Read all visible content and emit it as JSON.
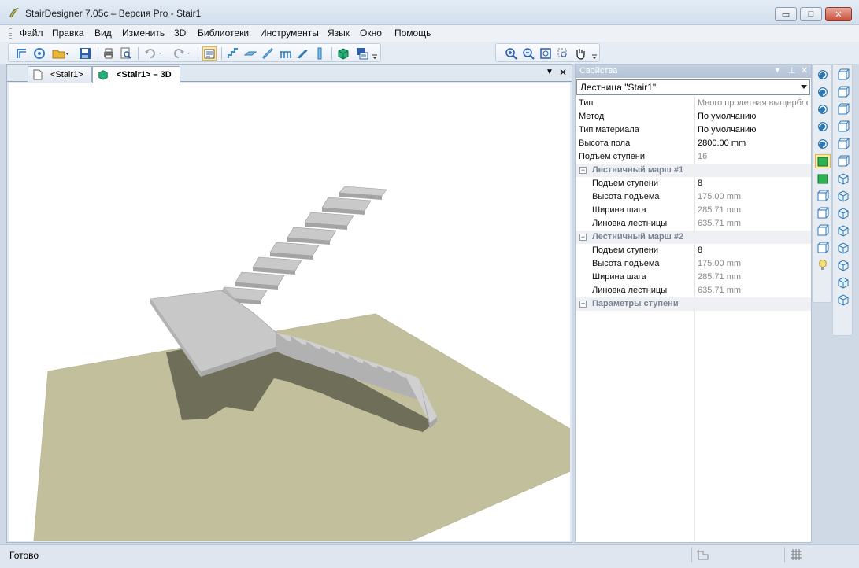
{
  "window": {
    "title": "StairDesigner 7.05c – Версия Pro - Stair1",
    "buttons": {
      "minimize": "▭",
      "maximize": "□",
      "close": "✕"
    }
  },
  "menu": {
    "items": [
      "Файл",
      "Правка",
      "Вид",
      "Изменить",
      "3D",
      "Библиотеки",
      "Инструменты",
      "Язык",
      "Окно",
      "Помощь"
    ]
  },
  "toolbar": {
    "icons": [
      "new-stair-icon",
      "rotate-icon",
      "open-folder-icon",
      "save-icon",
      "print-icon",
      "print-preview-icon",
      "undo-icon",
      "redo-icon",
      "properties-icon",
      "stair-type-icon",
      "landing-icon",
      "stringer-icon",
      "railing-icon",
      "flight-icon",
      "post-icon",
      "3d-view-icon",
      "2d-view-icon"
    ],
    "zoom_icons": [
      "zoom-in-icon",
      "zoom-out-icon",
      "zoom-extents-icon",
      "zoom-window-icon",
      "pan-hand-icon"
    ]
  },
  "tabs": [
    {
      "label": "<Stair1>",
      "active": false
    },
    {
      "label": "<Stair1> – 3D",
      "active": true
    }
  ],
  "tab_controls": {
    "dropdown": "▼",
    "close": "✕"
  },
  "properties": {
    "title": "Свойства",
    "header_controls": {
      "dropdown": "▼",
      "pin": "⊥",
      "close": "✕"
    },
    "selector": "Лестница \"Stair1\"",
    "rows": [
      {
        "name": "Тип",
        "value": "Много пролетная выщербленная",
        "gray": true,
        "kind": "top"
      },
      {
        "name": "Метод",
        "value": "По умолчанию",
        "gray": false,
        "kind": "top"
      },
      {
        "name": "Тип материала",
        "value": "По умолчанию",
        "gray": false,
        "kind": "top"
      },
      {
        "name": "Высота пола",
        "value": "2800.00 mm",
        "gray": false,
        "kind": "top"
      },
      {
        "name": "Подъем ступени",
        "value": "16",
        "gray": true,
        "kind": "top"
      },
      {
        "name": "Лестничный марш #1",
        "value": "",
        "kind": "group",
        "toggle": "−"
      },
      {
        "name": "Подъем ступени",
        "value": "8",
        "gray": false,
        "kind": "sub"
      },
      {
        "name": "Высота подъема",
        "value": "175.00 mm",
        "gray": true,
        "kind": "sub"
      },
      {
        "name": "Ширина шага",
        "value": "285.71 mm",
        "gray": true,
        "kind": "sub"
      },
      {
        "name": "Линовка лестницы",
        "value": "635.71 mm",
        "gray": true,
        "kind": "sub"
      },
      {
        "name": "Лестничный марш #2",
        "value": "",
        "kind": "group",
        "toggle": "−"
      },
      {
        "name": "Подъем ступени",
        "value": "8",
        "gray": false,
        "kind": "sub"
      },
      {
        "name": "Высота подъема",
        "value": "175.00 mm",
        "gray": true,
        "kind": "sub"
      },
      {
        "name": "Ширина шага",
        "value": "285.71 mm",
        "gray": true,
        "kind": "sub"
      },
      {
        "name": "Линовка лестницы",
        "value": "635.71 mm",
        "gray": true,
        "kind": "sub"
      },
      {
        "name": "Параметры ступени",
        "value": "",
        "kind": "group",
        "toggle": "+"
      }
    ]
  },
  "side_toolbar_left": [
    "rotate-left-icon",
    "rotate-right-icon",
    "orbit-icon",
    "orbit-reverse-icon",
    "auto-rotate-icon",
    "shaded-view-icon",
    "solid-view-icon",
    "wireframe-left-icon",
    "wireframe-right-icon",
    "hidden-line-icon",
    "box-view-icon",
    "light-bulb-icon"
  ],
  "side_toolbar_right": [
    "view-front-icon",
    "view-back-icon",
    "view-left-icon",
    "view-right-icon",
    "view-top-icon",
    "view-bottom-icon",
    "iso-view-1-icon",
    "iso-view-2-icon",
    "iso-view-3-icon",
    "iso-view-4-icon",
    "iso-view-5-icon",
    "iso-view-6-icon",
    "iso-view-7-icon",
    "iso-view-8-icon"
  ],
  "status": {
    "text": "Готово"
  },
  "colors": {
    "floor": "#c2bf9d",
    "stair_top": "#c8c8c8",
    "stair_side": "#a9a9a9",
    "shadow": "#6f6e58",
    "accent": "#4a8cc8"
  }
}
